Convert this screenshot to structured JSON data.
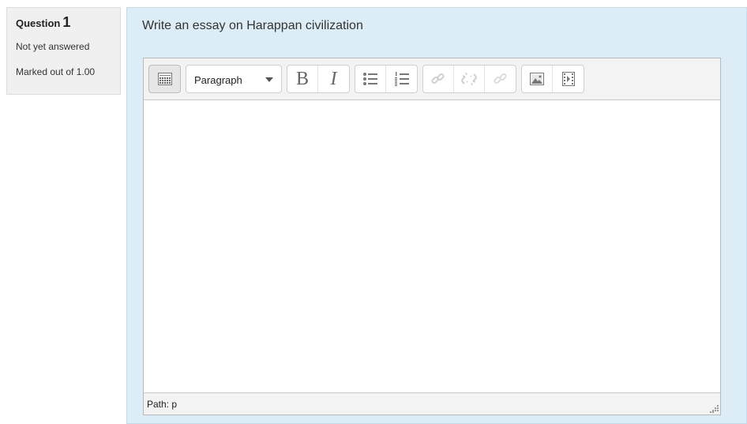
{
  "question_info": {
    "label": "Question",
    "number": "1",
    "state": "Not yet answered",
    "grade": "Marked out of 1.00"
  },
  "question": {
    "text": "Write an essay on Harappan civilization"
  },
  "editor": {
    "toolbar": {
      "toggle_icon": "toolbar-toggle-icon",
      "paragraph_format": "Paragraph",
      "bold_label": "B",
      "italic_label": "I",
      "icons": [
        "bulleted-list-icon",
        "numbered-list-icon",
        "link-icon",
        "unlink-icon",
        "anchor-icon",
        "image-icon",
        "media-icon"
      ]
    },
    "path_label": "Path: p"
  },
  "colors": {
    "content_background": "#dcedf7",
    "info_background": "#f0f0f0",
    "toolbar_background": "#f3f3f3"
  }
}
